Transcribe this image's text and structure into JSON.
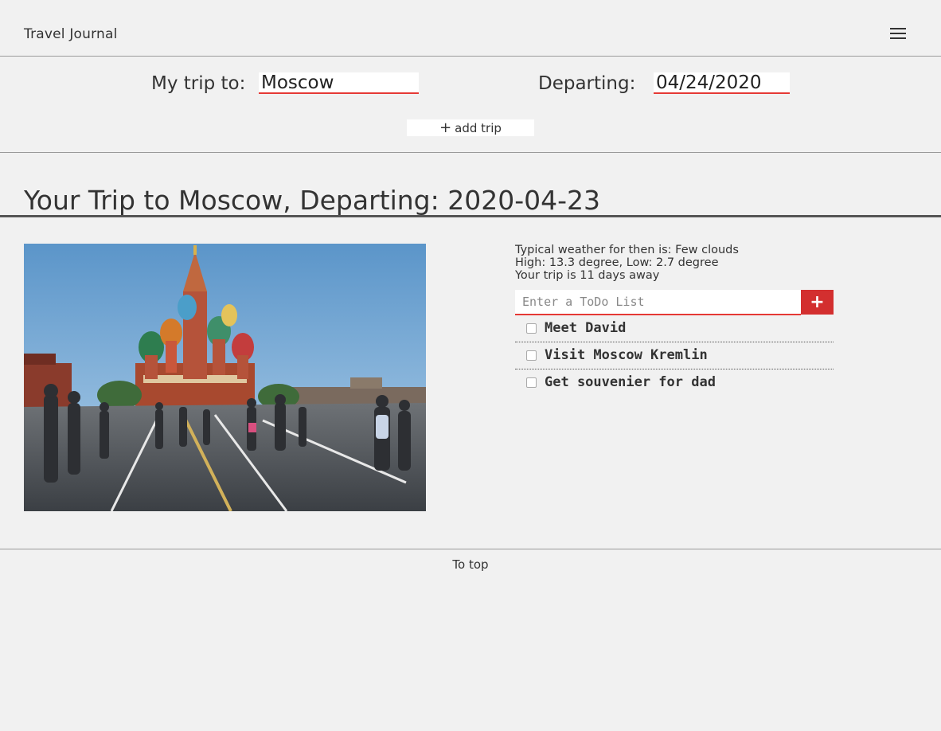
{
  "header": {
    "brand": "Travel Journal",
    "menu_icon": "hamburger-menu-icon"
  },
  "trip_form": {
    "destination_label": "My trip to:",
    "destination_value": "Moscow",
    "departing_label": "Departing:",
    "departing_value": "04/24/2020",
    "add_trip_icon": "plus-icon",
    "add_trip_label": "add trip"
  },
  "trip": {
    "title": "Your Trip to Moscow, Departing: 2020-04-23",
    "photo_subject": "Saint Basil's Cathedral, Red Square at dusk",
    "weather_line": "Typical weather for then is: Few clouds",
    "temps_line": "High: 13.3 degree, Low: 2.7 degree",
    "days_line": "Your trip is 11 days away"
  },
  "todo": {
    "placeholder": "Enter a ToDo List",
    "add_icon": "plus-icon",
    "items": [
      {
        "label": "Meet David",
        "checked": false
      },
      {
        "label": "Visit Moscow Kremlin",
        "checked": false
      },
      {
        "label": "Get souvenier for dad",
        "checked": false
      }
    ]
  },
  "footer": {
    "to_top_label": "To top"
  },
  "colors": {
    "background": "#f1f1f1",
    "accent_red": "#e53935",
    "button_red": "#d32f2f",
    "text": "#333333"
  }
}
